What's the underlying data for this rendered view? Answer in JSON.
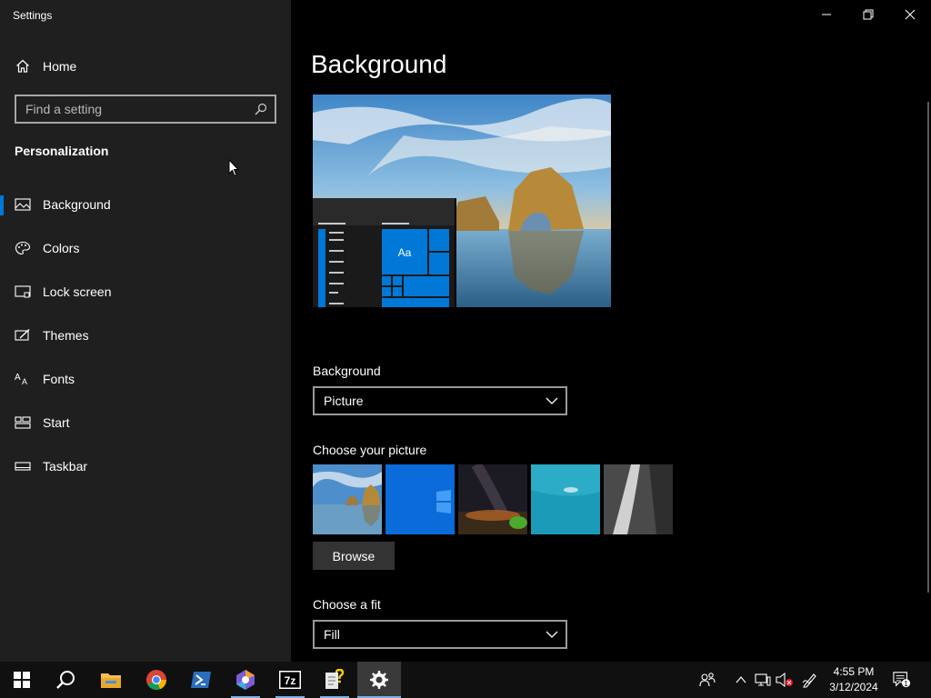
{
  "app": {
    "title": "Settings"
  },
  "sidebar": {
    "home_label": "Home",
    "search_placeholder": "Find a setting",
    "section_title": "Personalization",
    "items": [
      {
        "label": "Background",
        "icon": "picture-icon",
        "active": true
      },
      {
        "label": "Colors",
        "icon": "palette-icon"
      },
      {
        "label": "Lock screen",
        "icon": "lock-screen-icon"
      },
      {
        "label": "Themes",
        "icon": "brush-icon"
      },
      {
        "label": "Fonts",
        "icon": "fonts-icon"
      },
      {
        "label": "Start",
        "icon": "start-icon"
      },
      {
        "label": "Taskbar",
        "icon": "taskbar-icon"
      }
    ]
  },
  "main": {
    "title": "Background",
    "preview_tile_text": "Aa",
    "background_label": "Background",
    "background_value": "Picture",
    "choose_picture_label": "Choose your picture",
    "browse_label": "Browse",
    "fit_label": "Choose a fit",
    "fit_value": "Fill"
  },
  "taskbar": {
    "time": "4:55 PM",
    "date": "3/12/2024",
    "notification_count": "1",
    "app_7z_label": "7z"
  },
  "colors": {
    "accent": "#0078d7",
    "sidebar_bg": "#1f1f1f",
    "main_bg": "#000000"
  }
}
